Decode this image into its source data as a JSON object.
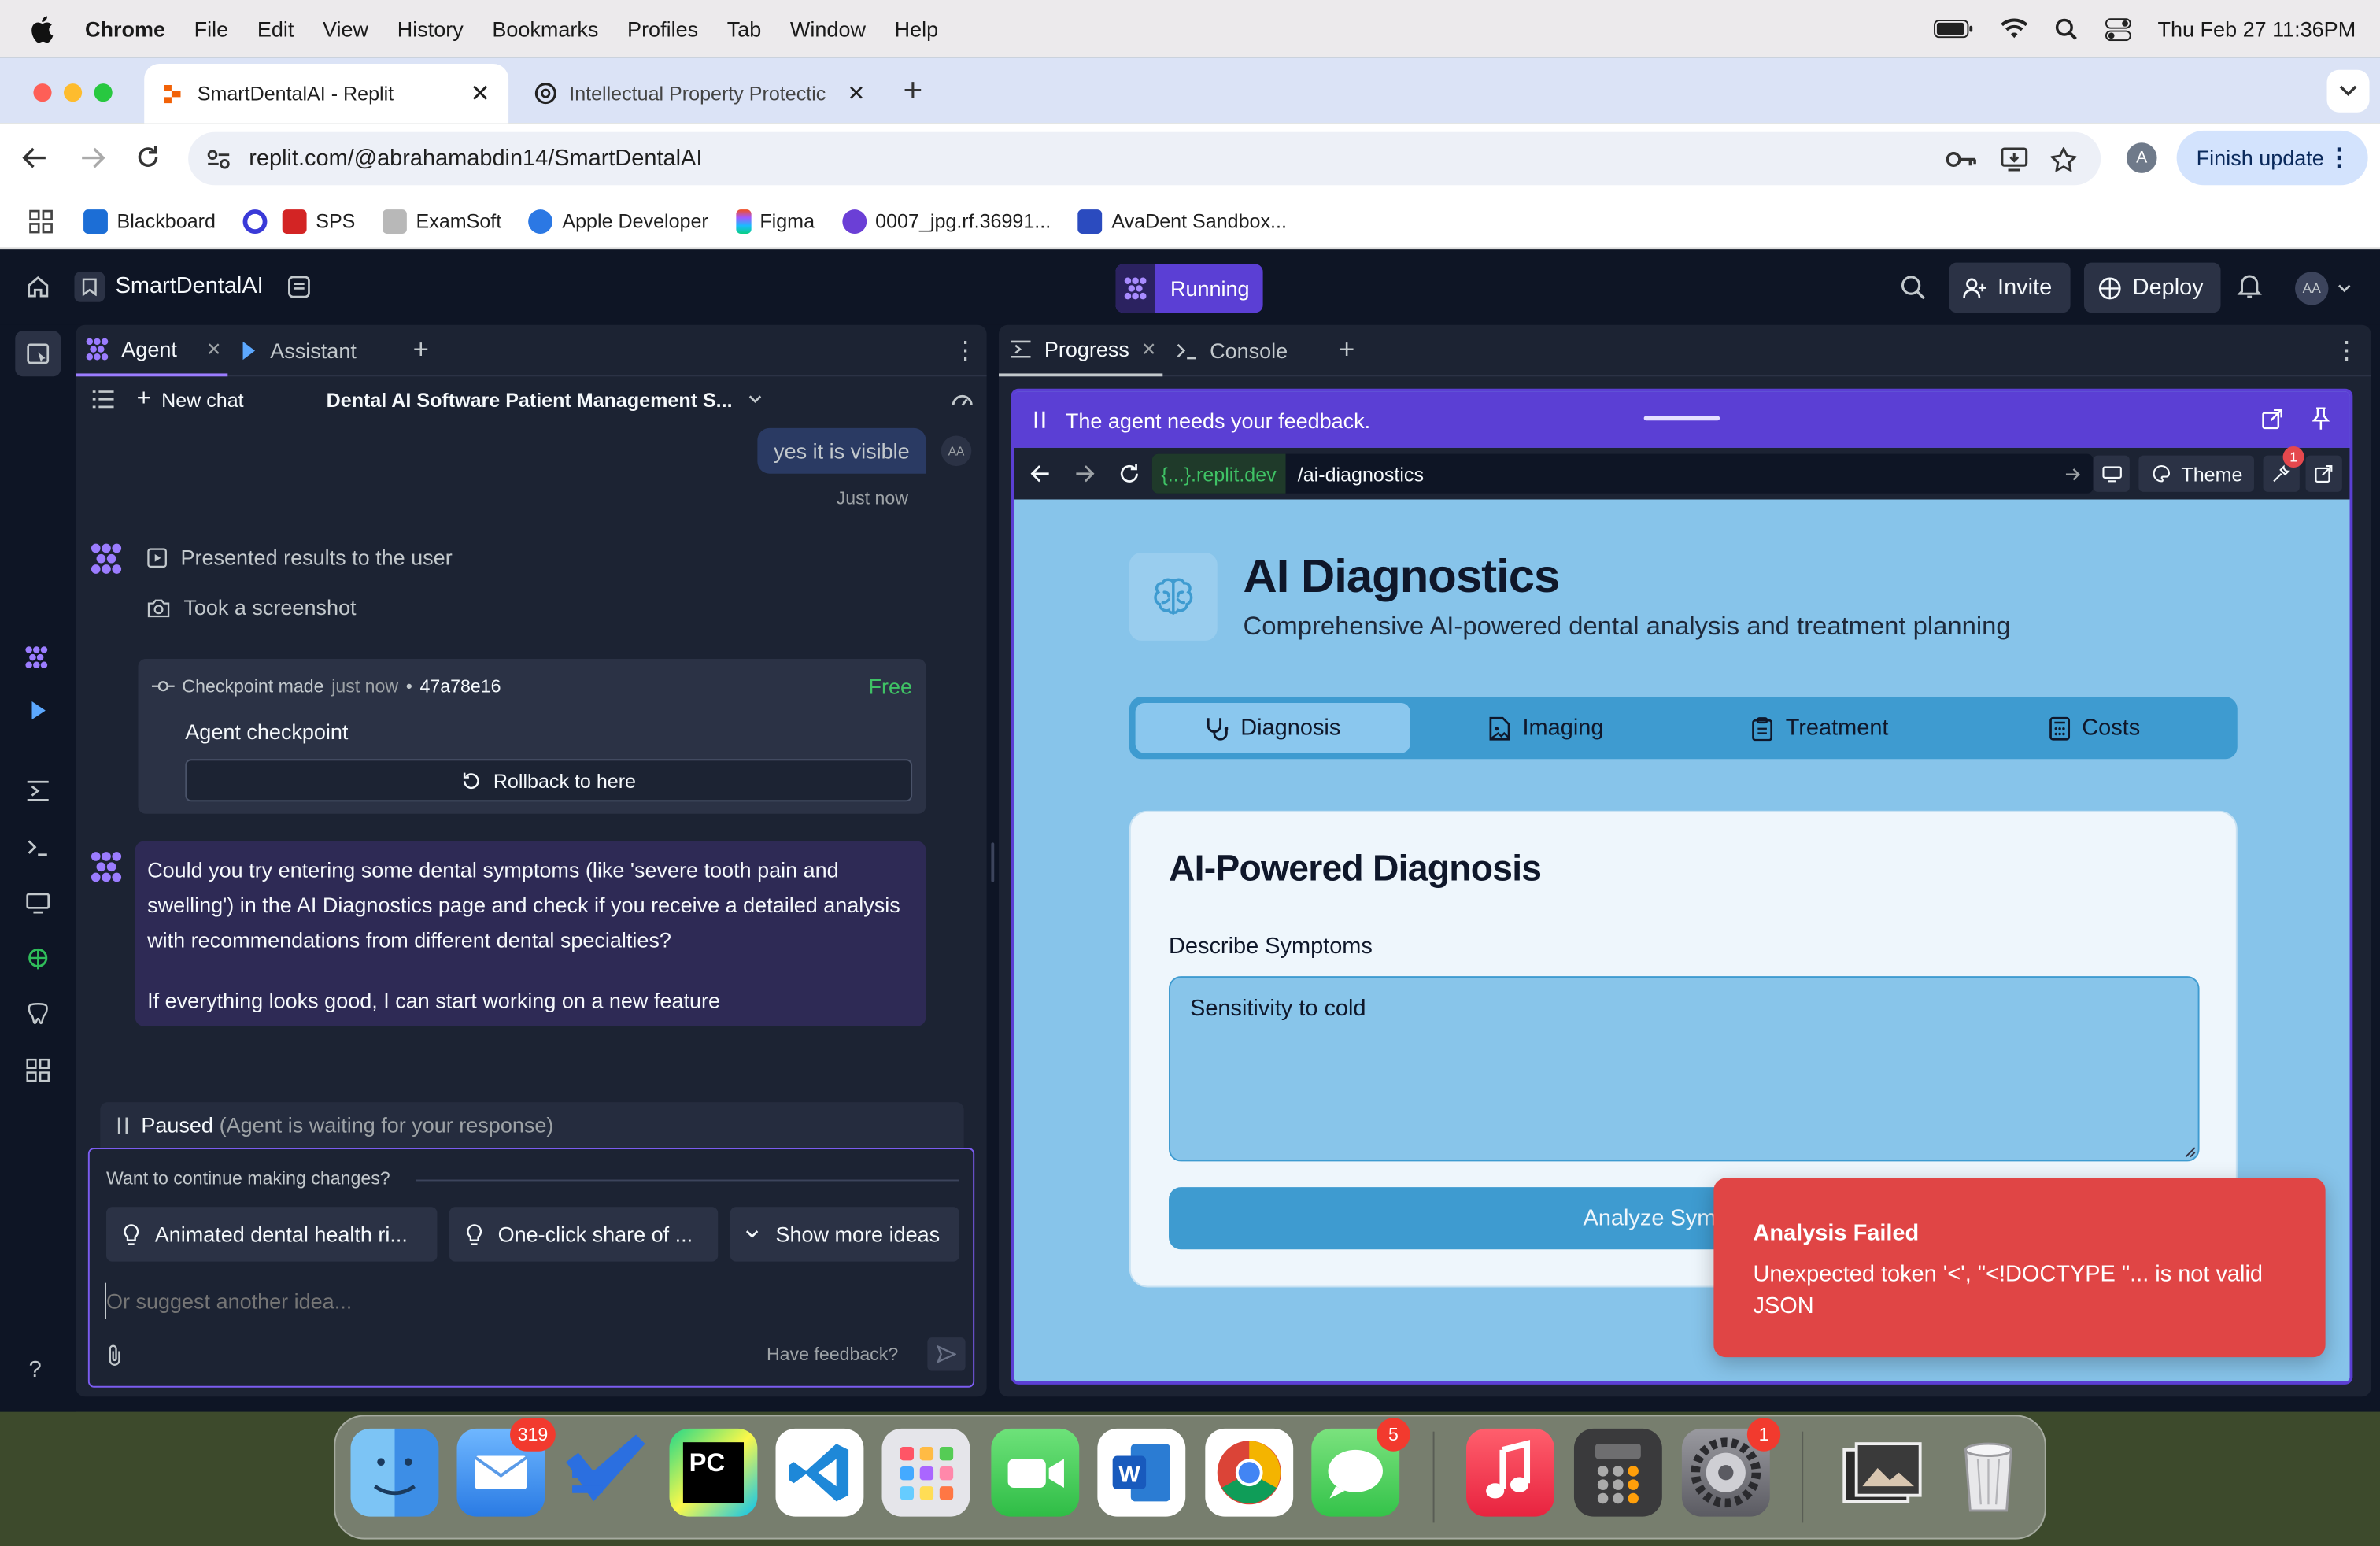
{
  "menubar": {
    "app": "Chrome",
    "items": [
      "File",
      "Edit",
      "View",
      "History",
      "Bookmarks",
      "Profiles",
      "Tab",
      "Window",
      "Help"
    ],
    "datetime": "Thu Feb 27  11:36PM"
  },
  "browser": {
    "tabs": [
      {
        "title": "SmartDentalAI - Replit"
      },
      {
        "title": "Intellectual Property Protectic"
      }
    ],
    "url": "replit.com/@abrahamabdin14/SmartDentalAI",
    "profile_initial": "A",
    "finish_update": "Finish update",
    "bookmarks": [
      "Blackboard",
      "SPS",
      "ExamSoft",
      "Apple Developer",
      "Figma",
      "0007_jpg.rf.36991...",
      "AvaDent Sandbox..."
    ],
    "bookmark_colors": [
      "#1c6ed6",
      "#3a3ad8",
      "#d32424",
      "#777777",
      "#2b78e4",
      "#f24e1e",
      "#6b3fd6",
      "#2b4bbf"
    ]
  },
  "replit": {
    "repl_name": "SmartDentalAI",
    "status": "Running",
    "invite": "Invite",
    "deploy": "Deploy",
    "avatar": "AA",
    "left_tabs": {
      "agent": "Agent",
      "assistant": "Assistant"
    },
    "new_chat": "New chat",
    "chat_title": "Dental AI Software Patient Management S...",
    "user_msg": "yes it is visible",
    "user_time": "Just now",
    "actions": [
      "Presented results to the user",
      "Took a screenshot"
    ],
    "checkpoint": {
      "label": "Checkpoint made",
      "when": "just now",
      "sep": "•",
      "hash": "47a78e16",
      "free": "Free",
      "title": "Agent checkpoint",
      "rollback": "Rollback to here"
    },
    "agent_msg_1": "Could you try entering some dental symptoms (like 'severe tooth pain and swelling') in the AI Diagnostics page and check if you receive a detailed analysis with recommendations from different dental specialties?",
    "agent_msg_2": "If everything looks good, I can start working on a new feature",
    "paused": "Paused",
    "paused_note": "(Agent is waiting for your response)",
    "continue_label": "Want to continue making changes?",
    "ideas": [
      "Animated dental health ri...",
      "One-click share of ...",
      "Show more ideas"
    ],
    "input_placeholder": "Or suggest another idea...",
    "have_feedback": "Have feedback?",
    "right_tabs": {
      "progress": "Progress",
      "console": "Console"
    },
    "feedback_bar": "The agent needs your feedback.",
    "preview_domain": "{...}.replit.dev",
    "preview_path": "/ai-diagnostics",
    "theme": "Theme",
    "notif_count": "1"
  },
  "app": {
    "title": "AI Diagnostics",
    "subtitle": "Comprehensive AI-powered dental analysis and treatment planning",
    "tabs": [
      "Diagnosis",
      "Imaging",
      "Treatment",
      "Costs"
    ],
    "card_title": "AI-Powered Diagnosis",
    "symptoms_label": "Describe Symptoms",
    "symptoms_value": "Sensitivity to cold",
    "analyze_button": "Analyze Sym",
    "toast_title": "Analysis Failed",
    "toast_body": "Unexpected token '<', \"<!DOCTYPE \"... is not valid JSON"
  },
  "dock": {
    "apps": [
      "Finder",
      "Mail",
      "Tasks",
      "PyCharm",
      "Visual Studio Code",
      "Launchpad",
      "FaceTime",
      "Microsoft Word",
      "Google Chrome",
      "Messages",
      "Music",
      "Calculator",
      "System Settings",
      "Photos",
      "Trash"
    ],
    "mail_badge": "319",
    "messages_badge": "5",
    "settings_badge": "1"
  }
}
